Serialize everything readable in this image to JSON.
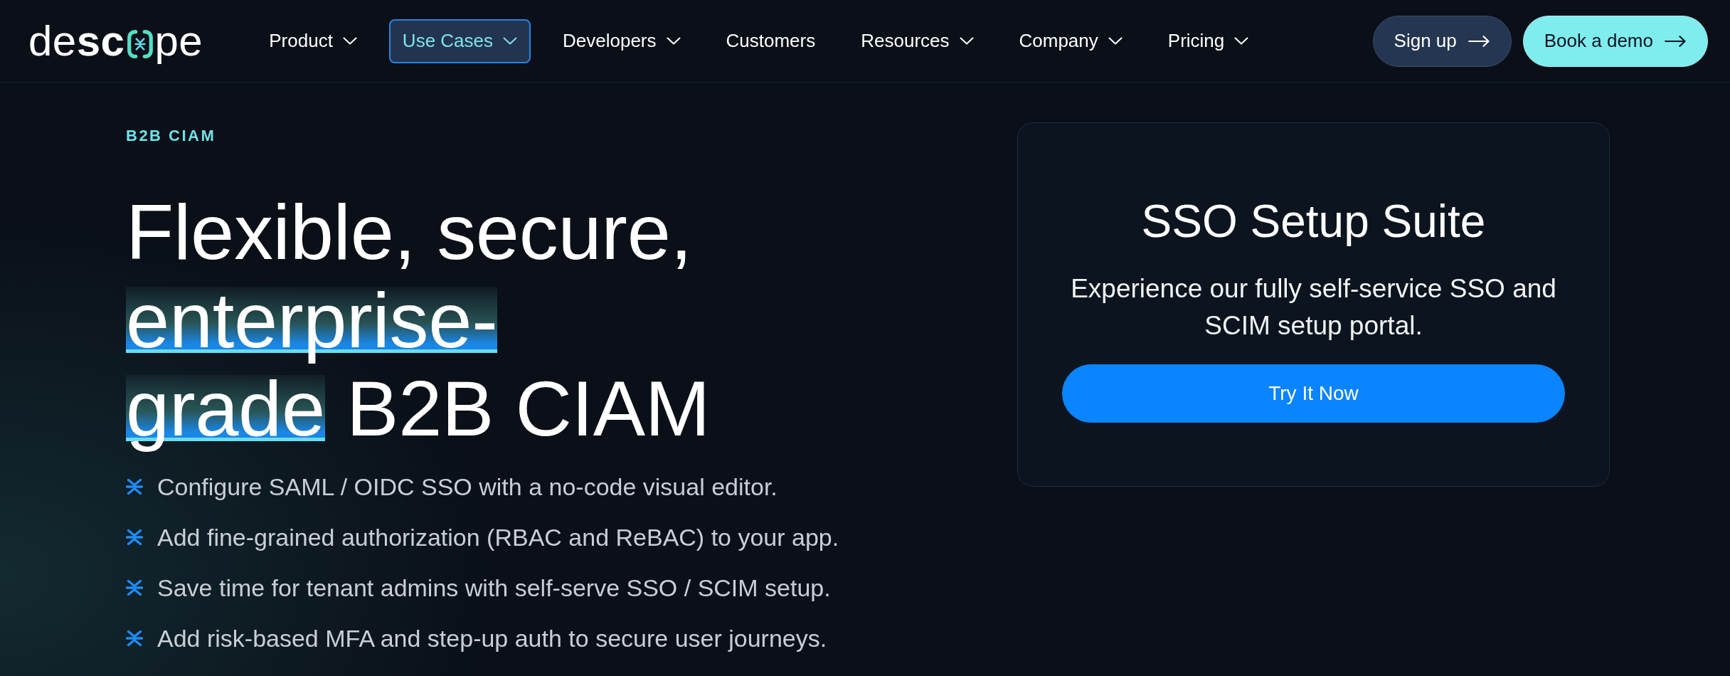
{
  "logo": {
    "start": "de**sc**",
    "end": "pe"
  },
  "nav": [
    {
      "label": "Product",
      "dropdown": true,
      "selected": false
    },
    {
      "label": "Use Cases",
      "dropdown": true,
      "selected": true
    },
    {
      "label": "Developers",
      "dropdown": true,
      "selected": false
    },
    {
      "label": "Customers",
      "dropdown": false,
      "selected": false
    },
    {
      "label": "Resources",
      "dropdown": true,
      "selected": false
    },
    {
      "label": "Company",
      "dropdown": true,
      "selected": false
    },
    {
      "label": "Pricing",
      "dropdown": true,
      "selected": false
    }
  ],
  "actions": [
    {
      "label": "Sign up",
      "kind": "secondary"
    },
    {
      "label": "Book a demo",
      "kind": "primary"
    }
  ],
  "hero": {
    "eyebrow": "B2B CIAM",
    "heading_lines": [
      [
        {
          "text": "Flexible, secure,",
          "highlight": false
        }
      ],
      [
        {
          "text": "enterprise-",
          "highlight": true
        }
      ],
      [
        {
          "text": "grade",
          "highlight": true
        },
        {
          "text": "B2B CIAM",
          "highlight": false
        }
      ]
    ],
    "features": [
      "Configure SAML / OIDC SSO with a no-code visual editor.",
      "Add fine-grained authorization (RBAC and ReBAC) to your app.",
      "Save time for tenant admins with self-serve SSO / SCIM setup.",
      "Add risk-based MFA and step-up auth to secure user journeys."
    ]
  },
  "card": {
    "title": "SSO Setup Suite",
    "description": "Experience our fully self-service SSO and SCIM setup portal.",
    "button": "Try It Now"
  }
}
